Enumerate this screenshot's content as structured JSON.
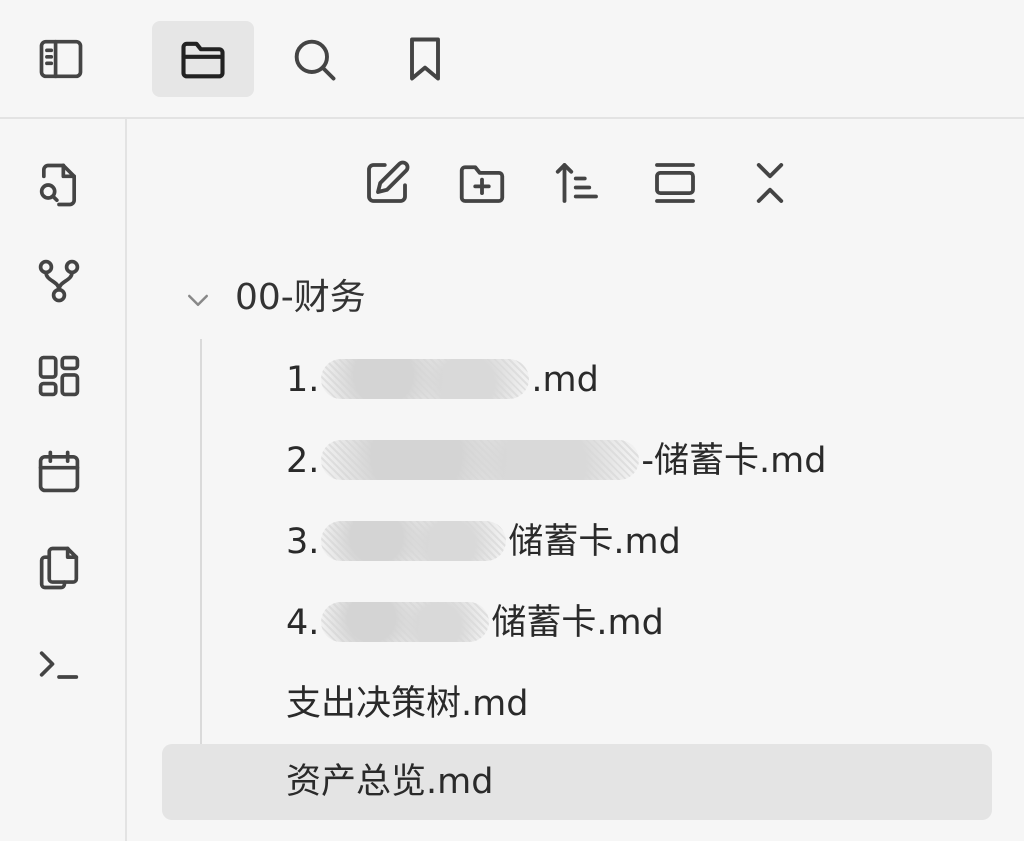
{
  "topbar": {
    "buttons": [
      {
        "icon": "sidebar-toggle-icon",
        "active": false
      },
      {
        "icon": "folder-icon",
        "active": true
      },
      {
        "icon": "search-icon",
        "active": false
      },
      {
        "icon": "bookmark-icon",
        "active": false
      }
    ]
  },
  "leftrail": {
    "buttons": [
      {
        "icon": "file-search-icon"
      },
      {
        "icon": "graph-icon"
      },
      {
        "icon": "grid-icon"
      },
      {
        "icon": "calendar-icon"
      },
      {
        "icon": "copy-icon"
      },
      {
        "icon": "terminal-icon"
      }
    ]
  },
  "explorer": {
    "toolbar": [
      "new-note-icon",
      "new-folder-icon",
      "sort-icon",
      "collapse-view-icon",
      "expand-collapse-icon"
    ],
    "folder": {
      "name": "00-财务",
      "expanded": true
    },
    "files": [
      {
        "prefix": "1.",
        "suffix": ".md",
        "active": false
      },
      {
        "prefix": "2.",
        "suffix": "-储蓄卡.md",
        "active": false
      },
      {
        "prefix": "3.",
        "suffix": "储蓄卡.md",
        "active": false
      },
      {
        "prefix": "4.",
        "suffix": "储蓄卡.md",
        "active": false
      },
      {
        "prefix": "支出决策树.md",
        "suffix": "",
        "active": false
      },
      {
        "prefix": "资产总览.md",
        "suffix": "",
        "active": true
      }
    ]
  }
}
